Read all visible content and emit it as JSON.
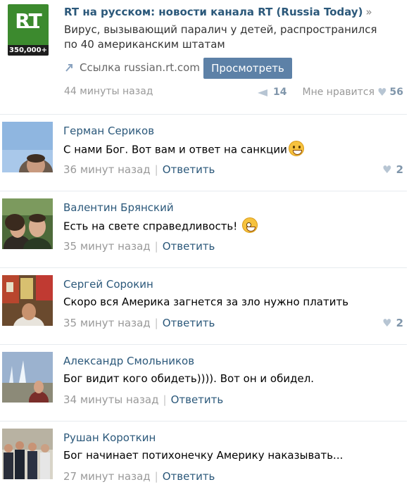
{
  "post": {
    "logo_text": "RT",
    "subscribers": "350,000+",
    "title": "RT на русском: новости канала RT (Russia Today)",
    "title_arrow": "»",
    "text": "Вирус, вызывающий паралич у детей, распространился по 40 американским штатам",
    "link_label": "Ссылка russian.rt.com",
    "view_button": "Просмотреть",
    "time": "44 минуты назад",
    "reposts": "14",
    "likes_label": "Мне нравится",
    "likes": "56"
  },
  "comments": [
    {
      "name": "Герман Сериков",
      "text": "С нами Бог. Вот вам и ответ на санкции",
      "time": "36 минут назад",
      "reply": "Ответить",
      "likes": "2"
    },
    {
      "name": "Валентин Брянский",
      "text": "Есть на свете справедливость!",
      "time": "35 минут назад",
      "reply": "Ответить",
      "likes": ""
    },
    {
      "name": "Сергей Сорокин",
      "text": "Скоро вся Америка загнется за зло нужно платить",
      "time": "35 минут назад",
      "reply": "Ответить",
      "likes": "2"
    },
    {
      "name": "Александр Смольников",
      "text": "Бог видит кого обидеть)))). Вот он и обидел.",
      "time": "34 минуты назад",
      "reply": "Ответить",
      "likes": ""
    },
    {
      "name": "Рушан Короткин",
      "text": "Бог начинает потихонечку Америку наказывать...",
      "time": "27 минут назад",
      "reply": "Ответить",
      "likes": ""
    }
  ],
  "separator": "|",
  "icons": {
    "link": "link-arrow-icon",
    "repost": "megaphone-icon",
    "like": "heart-icon",
    "emoji": "smiley-icon"
  },
  "colors": {
    "link_blue": "#2b587a",
    "button_blue": "#5d81a7",
    "logo_green": "#3c8a2e"
  }
}
